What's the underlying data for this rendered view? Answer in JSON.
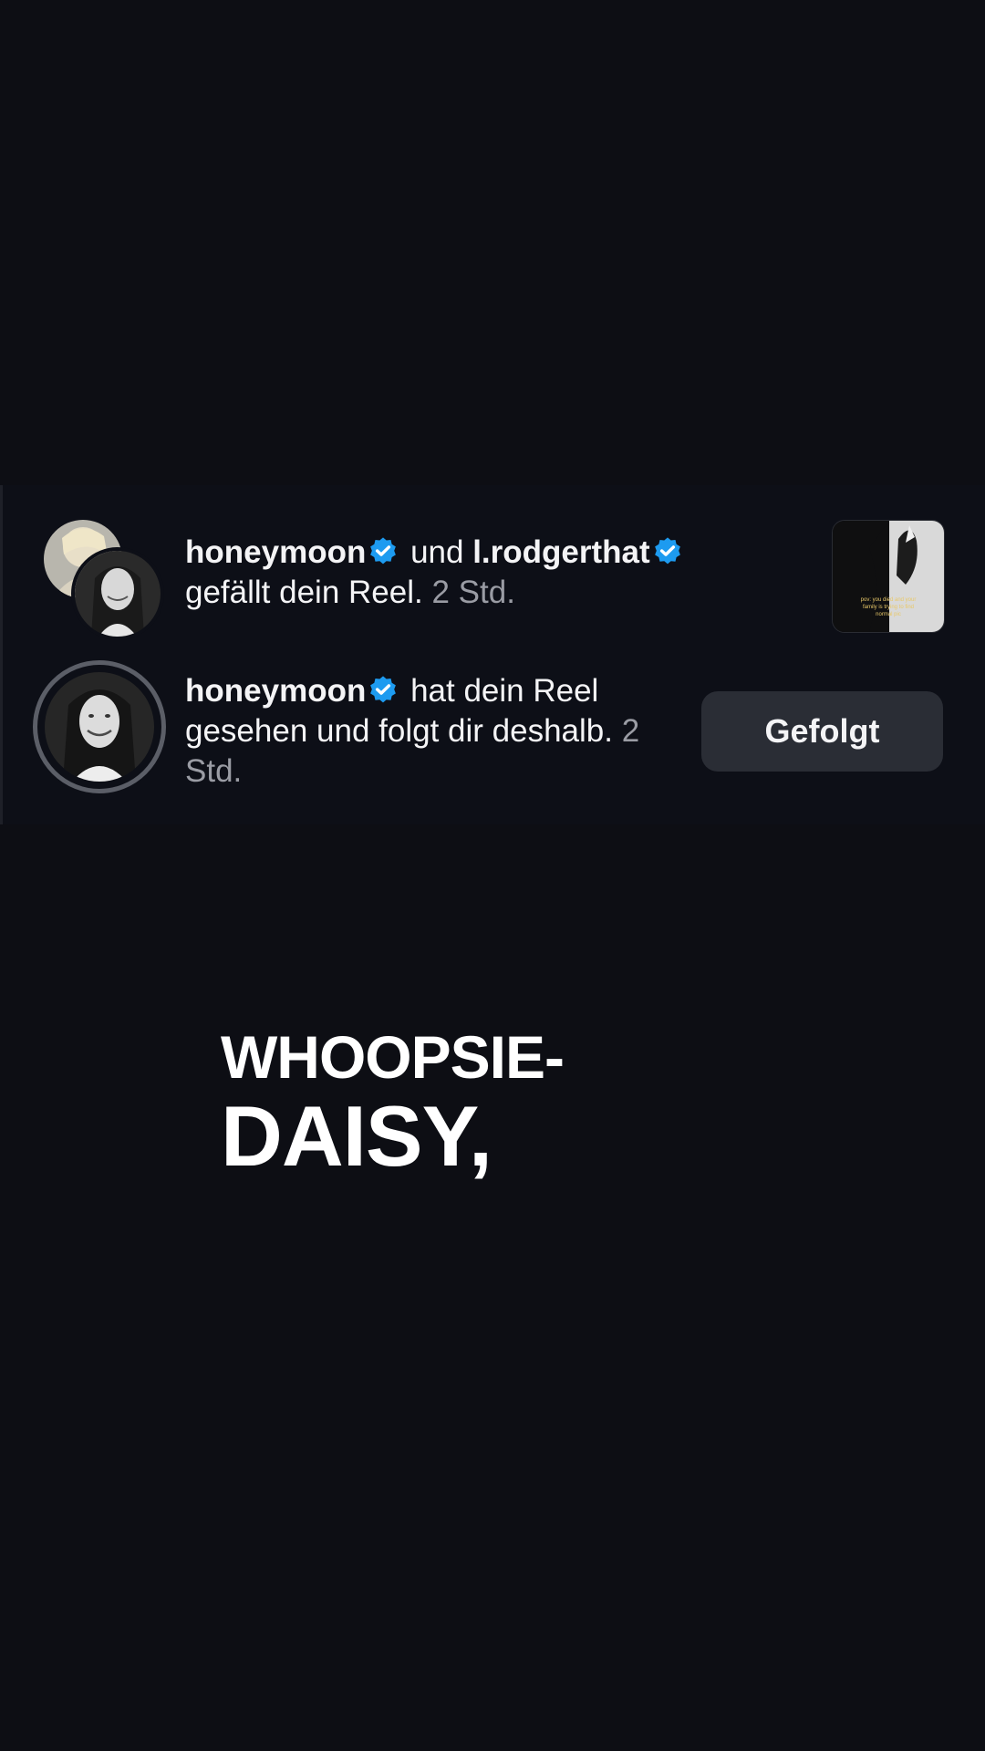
{
  "notifications": [
    {
      "user1": "honeymoon",
      "connector": "und",
      "user2": "l.rodgerthat",
      "action": "gefällt dein Reel.",
      "time": "2 Std.",
      "thumbnail_caption": "pov: you died and your family is trying to find normal pic"
    },
    {
      "user": "honeymoon",
      "action": "hat dein Reel gesehen und folgt dir deshalb.",
      "time": "2 Std.",
      "button_label": "Gefolgt"
    }
  ],
  "caption": {
    "line1": "WHOOPSIE-",
    "line2": "DAISY,"
  },
  "colors": {
    "background": "#0d0e14",
    "verified": "#1d9bf0",
    "button_bg": "#2a2d35",
    "muted_text": "#9a9ca4"
  },
  "icons": [
    "verified-badge-icon"
  ]
}
